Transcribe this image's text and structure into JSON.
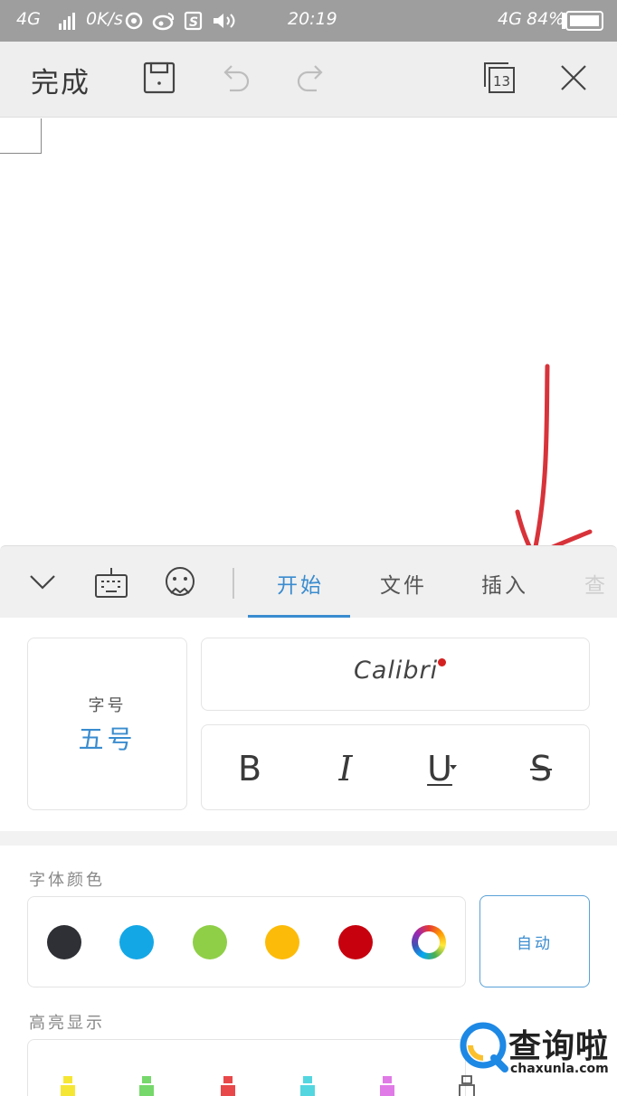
{
  "status_bar": {
    "network": "4G",
    "speed": "0K/s",
    "time": "20:19",
    "network2": "4G",
    "battery": "84%"
  },
  "toolbar": {
    "done_label": "完成",
    "icons": [
      "save-icon",
      "undo-icon",
      "redo-icon",
      "page-count-icon",
      "close-icon"
    ],
    "page_count": "13"
  },
  "tabs": {
    "items": [
      "开始",
      "文件",
      "插入",
      "查"
    ],
    "active": "开始"
  },
  "format": {
    "font_size_label": "字号",
    "font_size_value": "五号",
    "font_name": "Calibri",
    "style_buttons": [
      "B",
      "I",
      "U",
      "S"
    ]
  },
  "font_color": {
    "label": "字体颜色",
    "swatches": [
      "#2e3035",
      "#13a7e6",
      "#8fcf48",
      "#fdbb09",
      "#c7020e"
    ],
    "auto_label": "自动"
  },
  "highlight": {
    "label": "高亮显示",
    "markers": [
      "#f6e634",
      "#76d86b",
      "#e8484a",
      "#53d6e0",
      "#e07ae6"
    ]
  },
  "watermark": {
    "text": "查询啦",
    "url": "chaxunla.com"
  }
}
